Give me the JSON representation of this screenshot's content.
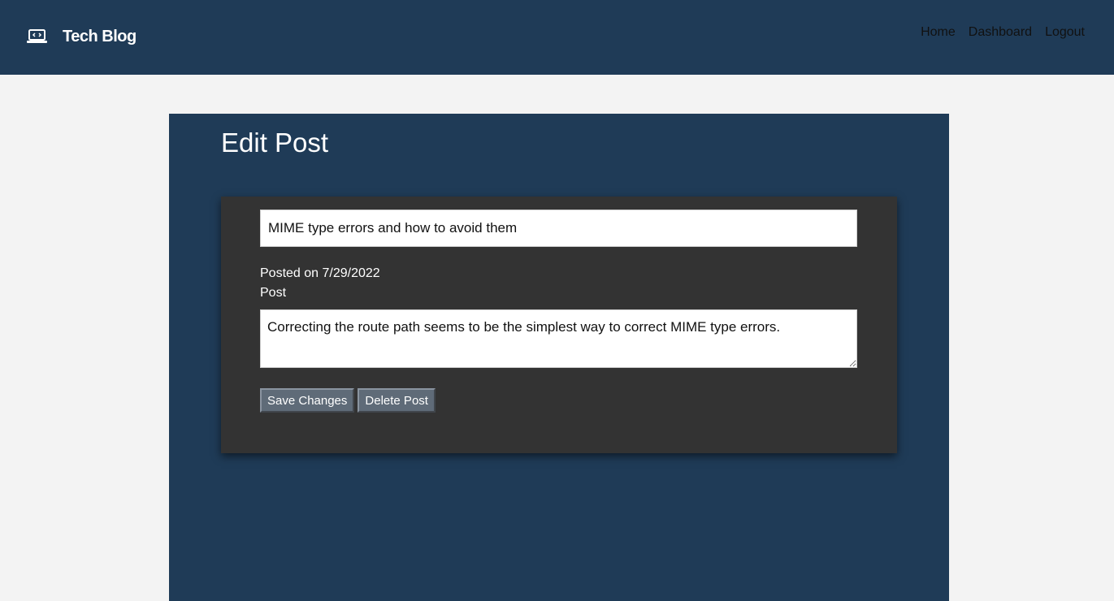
{
  "header": {
    "brand": "Tech Blog",
    "brand_icon": "laptop-code-icon",
    "nav": [
      "Home",
      "Dashboard",
      "Logout"
    ]
  },
  "main": {
    "title": "Edit Post",
    "form": {
      "title_value": "MIME type errors and how to avoid them",
      "posted": "Posted on 7/29/2022",
      "post_label": "Post",
      "body_value": "Correcting the route path seems to be the simplest way to correct MIME type errors.",
      "save_label": "Save Changes",
      "delete_label": "Delete Post"
    }
  },
  "colors": {
    "header_bg": "#1f3b57",
    "page_bg": "#f3f3f3",
    "card_bg": "#333333",
    "button_bg": "#5f6b78"
  }
}
